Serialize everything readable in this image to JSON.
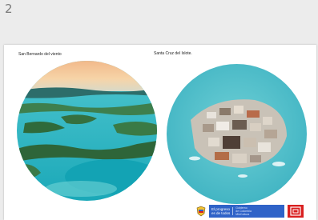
{
  "slide_number": "2",
  "slide": {
    "caption_left": "San Bernardo del viento",
    "caption_right": "Santa Cruz del Islote.",
    "image_left_name": "san-bernardo-aerial-photo",
    "image_right_name": "santa-cruz-islote-aerial-photo"
  },
  "footer": {
    "banner_text": "El progreso\nes de todos",
    "banner_subtext": "Gobierno\nde Colombia\nMinCultura",
    "logos": [
      "colombia-seal-icon",
      "mincultura-logo-icon"
    ]
  },
  "colors": {
    "slide_background": "#ffffff",
    "page_background": "#ececec",
    "banner_blue": "#2f63c8",
    "logo_red": "#d92020"
  }
}
